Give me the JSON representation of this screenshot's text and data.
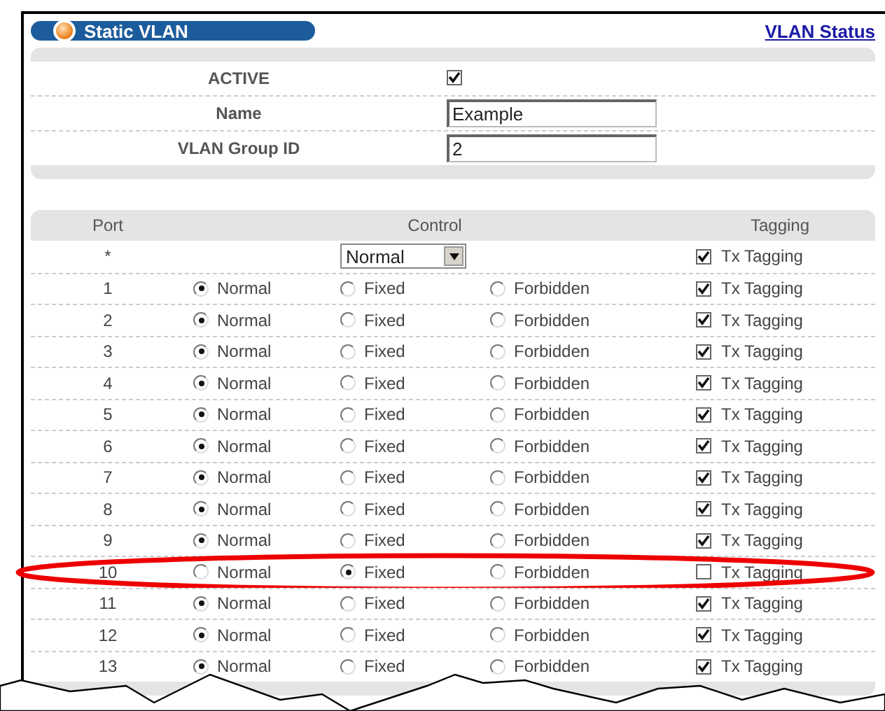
{
  "header": {
    "title": "Static VLAN",
    "link": "VLAN Status"
  },
  "form": [
    {
      "kind": "checkbox",
      "label": "ACTIVE",
      "checked": true
    },
    {
      "kind": "text",
      "label": "Name",
      "value": "Example"
    },
    {
      "kind": "text",
      "label": "VLAN Group ID",
      "value": "2"
    }
  ],
  "table": {
    "columns": [
      "Port",
      "Control",
      "Tagging"
    ],
    "all_row": {
      "port": "*",
      "control": "Normal",
      "tagging": {
        "label": "Tx Tagging",
        "checked": true
      }
    },
    "rows": [
      {
        "port": "1",
        "highlighted": false,
        "options": [
          {
            "label": "Normal",
            "selected": true
          },
          {
            "label": "Fixed",
            "selected": false
          },
          {
            "label": "Forbidden",
            "selected": false
          }
        ],
        "tagging": {
          "label": "Tx Tagging",
          "checked": true
        }
      },
      {
        "port": "2",
        "highlighted": false,
        "options": [
          {
            "label": "Normal",
            "selected": true
          },
          {
            "label": "Fixed",
            "selected": false
          },
          {
            "label": "Forbidden",
            "selected": false
          }
        ],
        "tagging": {
          "label": "Tx Tagging",
          "checked": true
        }
      },
      {
        "port": "3",
        "highlighted": false,
        "options": [
          {
            "label": "Normal",
            "selected": true
          },
          {
            "label": "Fixed",
            "selected": false
          },
          {
            "label": "Forbidden",
            "selected": false
          }
        ],
        "tagging": {
          "label": "Tx Tagging",
          "checked": true
        }
      },
      {
        "port": "4",
        "highlighted": false,
        "options": [
          {
            "label": "Normal",
            "selected": true
          },
          {
            "label": "Fixed",
            "selected": false
          },
          {
            "label": "Forbidden",
            "selected": false
          }
        ],
        "tagging": {
          "label": "Tx Tagging",
          "checked": true
        }
      },
      {
        "port": "5",
        "highlighted": false,
        "options": [
          {
            "label": "Normal",
            "selected": true
          },
          {
            "label": "Fixed",
            "selected": false
          },
          {
            "label": "Forbidden",
            "selected": false
          }
        ],
        "tagging": {
          "label": "Tx Tagging",
          "checked": true
        }
      },
      {
        "port": "6",
        "highlighted": false,
        "options": [
          {
            "label": "Normal",
            "selected": true
          },
          {
            "label": "Fixed",
            "selected": false
          },
          {
            "label": "Forbidden",
            "selected": false
          }
        ],
        "tagging": {
          "label": "Tx Tagging",
          "checked": true
        }
      },
      {
        "port": "7",
        "highlighted": false,
        "options": [
          {
            "label": "Normal",
            "selected": true
          },
          {
            "label": "Fixed",
            "selected": false
          },
          {
            "label": "Forbidden",
            "selected": false
          }
        ],
        "tagging": {
          "label": "Tx Tagging",
          "checked": true
        }
      },
      {
        "port": "8",
        "highlighted": false,
        "options": [
          {
            "label": "Normal",
            "selected": true
          },
          {
            "label": "Fixed",
            "selected": false
          },
          {
            "label": "Forbidden",
            "selected": false
          }
        ],
        "tagging": {
          "label": "Tx Tagging",
          "checked": true
        }
      },
      {
        "port": "9",
        "highlighted": false,
        "options": [
          {
            "label": "Normal",
            "selected": true
          },
          {
            "label": "Fixed",
            "selected": false
          },
          {
            "label": "Forbidden",
            "selected": false
          }
        ],
        "tagging": {
          "label": "Tx Tagging",
          "checked": true
        }
      },
      {
        "port": "10",
        "highlighted": true,
        "options": [
          {
            "label": "Normal",
            "selected": false
          },
          {
            "label": "Fixed",
            "selected": true
          },
          {
            "label": "Forbidden",
            "selected": false
          }
        ],
        "tagging": {
          "label": "Tx Tagging",
          "checked": false
        }
      },
      {
        "port": "11",
        "highlighted": false,
        "options": [
          {
            "label": "Normal",
            "selected": true
          },
          {
            "label": "Fixed",
            "selected": false
          },
          {
            "label": "Forbidden",
            "selected": false
          }
        ],
        "tagging": {
          "label": "Tx Tagging",
          "checked": true
        }
      },
      {
        "port": "12",
        "highlighted": false,
        "options": [
          {
            "label": "Normal",
            "selected": true
          },
          {
            "label": "Fixed",
            "selected": false
          },
          {
            "label": "Forbidden",
            "selected": false
          }
        ],
        "tagging": {
          "label": "Tx Tagging",
          "checked": true
        }
      },
      {
        "port": "13",
        "highlighted": false,
        "options": [
          {
            "label": "Normal",
            "selected": true
          },
          {
            "label": "Fixed",
            "selected": false
          },
          {
            "label": "Forbidden",
            "selected": false
          }
        ],
        "tagging": {
          "label": "Tx Tagging",
          "checked": true
        }
      }
    ]
  }
}
